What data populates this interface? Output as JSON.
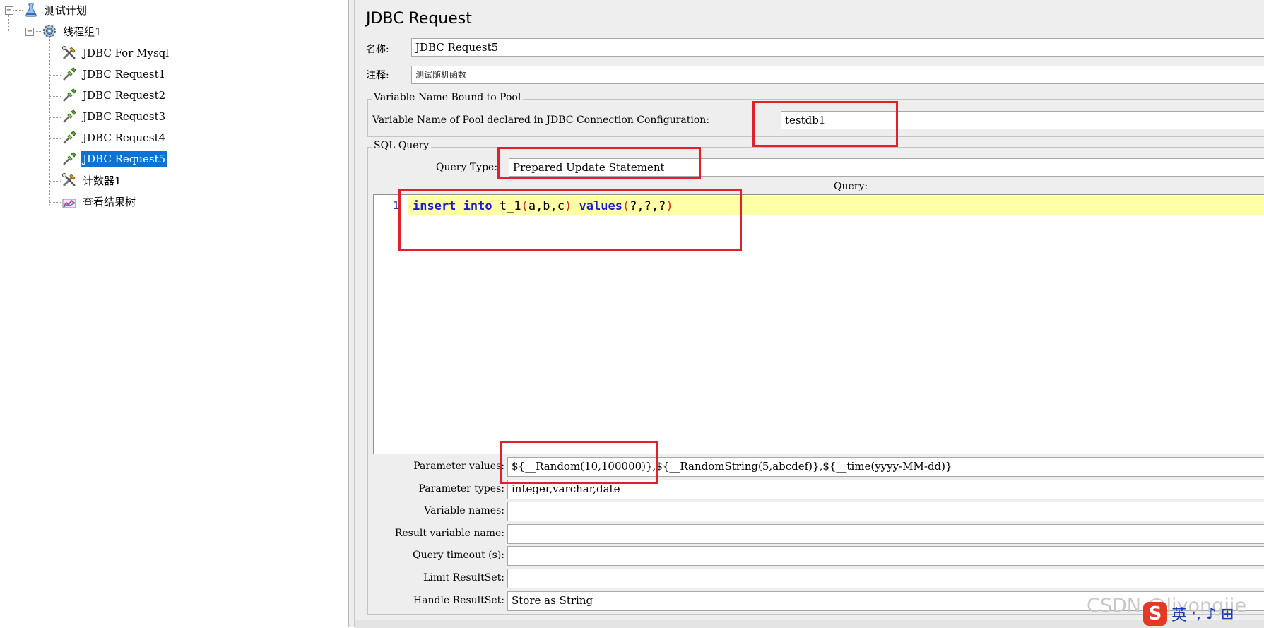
{
  "tree": {
    "items": [
      {
        "label": "测试计划",
        "icon": "flask-icon"
      },
      {
        "label": "线程组1",
        "icon": "gear-icon"
      },
      {
        "label": "JDBC For Mysql",
        "icon": "config-tools-icon"
      },
      {
        "label": "JDBC Request1",
        "icon": "sampler-pipette-icon"
      },
      {
        "label": "JDBC Request2",
        "icon": "sampler-pipette-icon"
      },
      {
        "label": "JDBC Request3",
        "icon": "sampler-pipette-icon"
      },
      {
        "label": "JDBC Request4",
        "icon": "sampler-pipette-icon"
      },
      {
        "label": "JDBC Request5",
        "icon": "sampler-pipette-icon"
      },
      {
        "label": "计数器1",
        "icon": "config-tools-icon"
      },
      {
        "label": "查看结果树",
        "icon": "chart-listener-icon"
      }
    ],
    "selected_index": 7
  },
  "panel": {
    "title": "JDBC Request",
    "name_label": "名称:",
    "name_value": "JDBC Request5",
    "comment_label": "注释:",
    "comment_value": "测试随机函数"
  },
  "pool": {
    "group_title": "Variable Name Bound to Pool",
    "label": "Variable Name of Pool declared in JDBC Connection Configuration:",
    "value": "testdb1"
  },
  "sql": {
    "group_title": "SQL Query",
    "query_type_label": "Query Type:",
    "query_type_value": "Prepared Update Statement",
    "query_header": "Query:",
    "line_number": "1",
    "code_tokens": [
      {
        "t": "insert",
        "c": "kw"
      },
      {
        "t": " ",
        "c": ""
      },
      {
        "t": "into",
        "c": "kw"
      },
      {
        "t": " t_1",
        "c": ""
      },
      {
        "t": "(",
        "c": "par"
      },
      {
        "t": "a,b,c",
        "c": ""
      },
      {
        "t": ")",
        "c": "par"
      },
      {
        "t": " ",
        "c": ""
      },
      {
        "t": "values",
        "c": "kw"
      },
      {
        "t": "(",
        "c": "par"
      },
      {
        "t": "?,?,?",
        "c": ""
      },
      {
        "t": ")",
        "c": "par"
      }
    ]
  },
  "params": [
    {
      "label": "Parameter values:",
      "value": "${__Random(10,100000)},${__RandomString(5,abcdef)},${__time(yyyy-MM-dd)}"
    },
    {
      "label": "Parameter types:",
      "value": "integer,varchar,date"
    },
    {
      "label": "Variable names:",
      "value": ""
    },
    {
      "label": "Result variable name:",
      "value": ""
    },
    {
      "label": "Query timeout (s):",
      "value": ""
    },
    {
      "label": "Limit ResultSet:",
      "value": ""
    },
    {
      "label": "Handle ResultSet:",
      "value": "Store as String"
    }
  ],
  "overlay": {
    "watermark": "CSDN @liyongjie",
    "ime_logo": "S",
    "ime_lang": "英",
    "ime_items": "·, ♪ ⊞"
  },
  "colors": {
    "selection": "#0a74d4",
    "highlight_box": "#e0202a",
    "keyword": "#1b1bd0",
    "paren": "#d62a2a",
    "current_line": "#ffffa8"
  }
}
